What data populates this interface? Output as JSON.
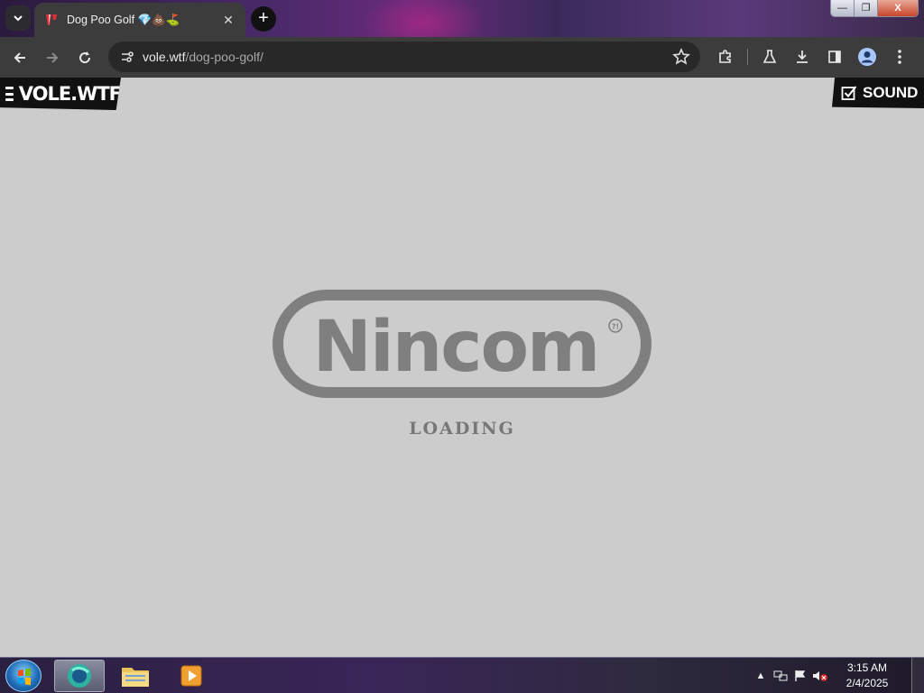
{
  "browser": {
    "tab": {
      "title": "Dog Poo Golf 💎💩⛳",
      "favicon": "vole-favicon-icon"
    },
    "url": {
      "host": "vole.wtf",
      "path": "/dog-poo-golf/"
    },
    "window_controls": {
      "minimize": "—",
      "restore": "❐",
      "close": "X"
    }
  },
  "page": {
    "logo_text": "VOLE.WTF",
    "sound_label": "SOUND",
    "sound_checked": true,
    "splash": {
      "brand": "Nincom",
      "mark": "?!",
      "loading_text": "LOADING"
    }
  },
  "taskbar": {
    "clock_time": "3:15 AM",
    "clock_date": "2/4/2025"
  },
  "colors": {
    "page_bg": "#cccccc",
    "logo_gray": "#7f7f7f",
    "chrome_toolbar": "#3c3c3c"
  }
}
